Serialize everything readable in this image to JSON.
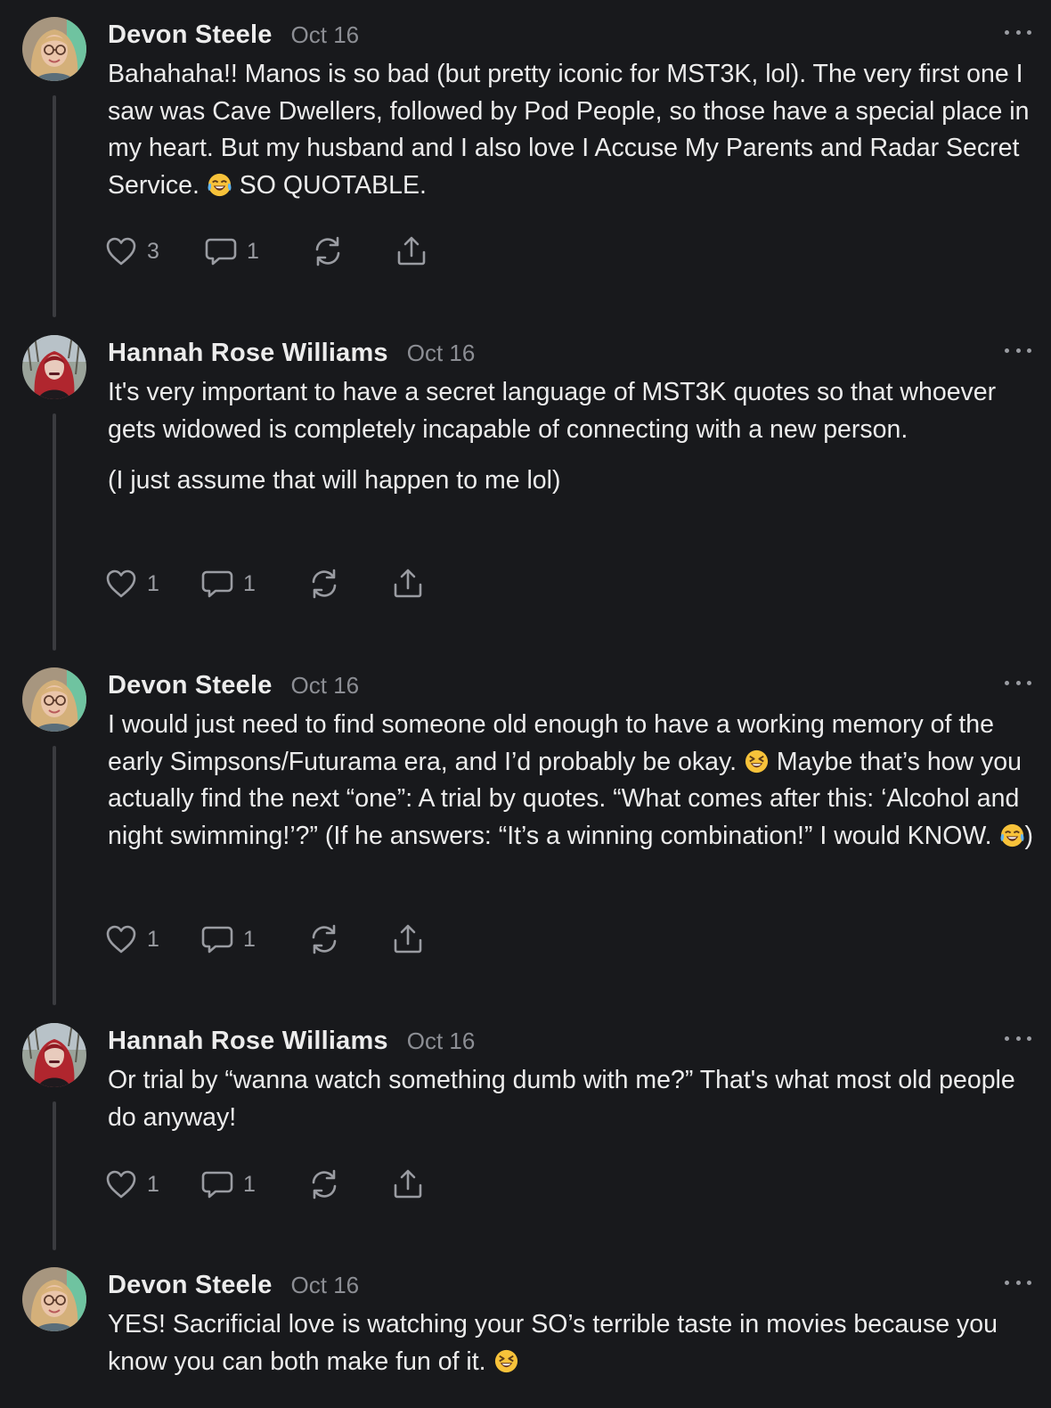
{
  "comments": [
    {
      "author": "Devon Steele",
      "date": "Oct 16",
      "avatar": "avatar-devon",
      "paragraphs": [
        [
          {
            "text": "Bahahaha!! Manos is so bad (but pretty iconic for MST3K, lol). The very first one I saw was Cave Dwellers, followed by Pod People, so those have a special place in my heart. But my husband and I also love I Accuse My Parents and Radar Secret Service. "
          },
          {
            "emoji": "tears-of-joy"
          },
          {
            "text": " SO QUOTABLE."
          }
        ]
      ],
      "likes": "3",
      "replies": "1"
    },
    {
      "author": "Hannah Rose Williams",
      "date": "Oct 16",
      "avatar": "avatar-hannah",
      "paragraphs": [
        [
          {
            "text": "It's very important to have a secret language of MST3K quotes so that whoever gets widowed is completely incapable of connecting with a new person."
          }
        ],
        [
          {
            "text": "(I just assume that will happen to me lol)"
          }
        ]
      ],
      "likes": "1",
      "replies": "1"
    },
    {
      "author": "Devon Steele",
      "date": "Oct 16",
      "avatar": "avatar-devon",
      "paragraphs": [
        [
          {
            "text": "I would just need to find someone old enough to have a working memory of the early Simpsons/Futurama era, and I’d probably be okay. "
          },
          {
            "emoji": "squinting-laugh"
          },
          {
            "text": " Maybe that’s how you actually find the next “one”: A trial by quotes. “What comes after this: ‘Alcohol and night swimming!’?” (If he answers: “It’s a winning combination!” I would KNOW. "
          },
          {
            "emoji": "tears-of-joy"
          },
          {
            "text": ")"
          }
        ]
      ],
      "likes": "1",
      "replies": "1"
    },
    {
      "author": "Hannah Rose Williams",
      "date": "Oct 16",
      "avatar": "avatar-hannah",
      "paragraphs": [
        [
          {
            "text": "Or trial by “wanna watch something dumb with me?” That's what most old people do anyway!"
          }
        ]
      ],
      "likes": "1",
      "replies": "1"
    },
    {
      "author": "Devon Steele",
      "date": "Oct 16",
      "avatar": "avatar-devon",
      "paragraphs": [
        [
          {
            "text": "YES! Sacrificial love is watching your SO’s terrible taste in movies because you know you can both make fun of it. "
          },
          {
            "emoji": "squinting-laugh"
          }
        ]
      ],
      "likes": null,
      "replies": null
    }
  ],
  "icons": {
    "like": "heart-icon",
    "reply": "comment-bubble-icon",
    "restack": "restack-icon",
    "share": "share-icon",
    "more": "more-options-icon"
  },
  "colors": {
    "background": "#18191c",
    "text": "#ececec",
    "muted": "#8c8e94",
    "thread_line": "#3a3b3f"
  }
}
